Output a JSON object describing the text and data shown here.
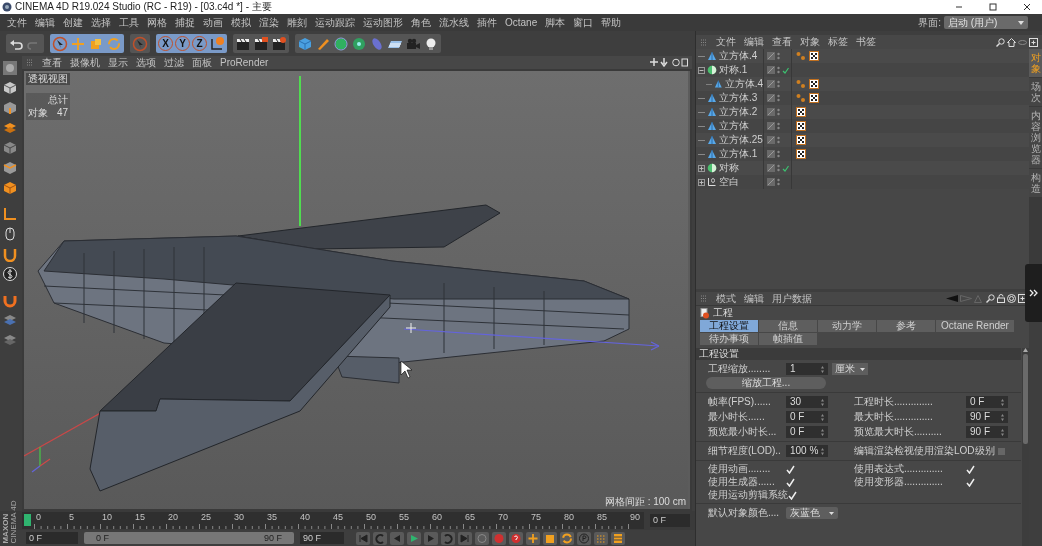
{
  "window": {
    "title": "CINEMA 4D R19.024 Studio (RC - R19) - [03.c4d *] - 主要"
  },
  "menu": [
    "文件",
    "编辑",
    "创建",
    "选择",
    "工具",
    "网格",
    "捕捉",
    "动画",
    "模拟",
    "渲染",
    "雕刻",
    "运动跟踪",
    "运动图形",
    "角色",
    "流水线",
    "插件",
    "Octane",
    "脚本",
    "窗口",
    "帮助"
  ],
  "layout_selector": {
    "label": "界面:",
    "value": "启动 (用户)"
  },
  "axis_buttons": [
    "X",
    "Y",
    "Z"
  ],
  "viewport": {
    "menu": [
      "查看",
      "摄像机",
      "显示",
      "选项",
      "过滤",
      "面板",
      "ProRender"
    ],
    "view_name": "透视视图",
    "hud_title": "总计",
    "hud_rows": [
      {
        "label": "对象",
        "value": "47"
      }
    ],
    "grid_spacing": "网格间距 : 100 cm"
  },
  "timeline": {
    "ticks": [
      "0",
      "5",
      "10",
      "15",
      "20",
      "25",
      "30",
      "35",
      "40",
      "45",
      "50",
      "55",
      "60",
      "65",
      "70",
      "75",
      "80",
      "85",
      "90"
    ],
    "current_frame": "0 F",
    "start": "0 F",
    "range_start": "0 F",
    "range_end": "90 F",
    "end": "90 F"
  },
  "object_manager": {
    "menu": [
      "文件",
      "编辑",
      "查看",
      "对象",
      "标签",
      "书签"
    ],
    "objects": [
      {
        "name": "立方体.4",
        "kind": "cube",
        "enabled": false,
        "tags": [
          {
            "kind": "vertex"
          },
          {
            "kind": "material"
          }
        ]
      },
      {
        "name": "对称.1",
        "kind": "symmetry",
        "enabled": true,
        "expanded": true,
        "children": [
          {
            "name": "立方体.4",
            "kind": "cube",
            "enabled": false,
            "tags": [
              {
                "kind": "vertex"
              },
              {
                "kind": "material"
              }
            ]
          }
        ]
      },
      {
        "name": "立方体.3",
        "kind": "cube",
        "enabled": false,
        "tags": [
          {
            "kind": "vertex"
          },
          {
            "kind": "material"
          }
        ]
      },
      {
        "name": "立方体.2",
        "kind": "cube",
        "enabled": false,
        "tags": [
          {
            "kind": "material"
          }
        ]
      },
      {
        "name": "立方体",
        "kind": "cube",
        "enabled": false,
        "tags": [
          {
            "kind": "material"
          }
        ]
      },
      {
        "name": "立方体.25",
        "kind": "cube",
        "enabled": false,
        "tags": [
          {
            "kind": "material"
          }
        ]
      },
      {
        "name": "立方体.1",
        "kind": "cube",
        "enabled": false,
        "tags": [
          {
            "kind": "material"
          }
        ]
      },
      {
        "name": "对称",
        "kind": "symmetry",
        "enabled": true,
        "expanded": false
      },
      {
        "name": "空白",
        "kind": "null",
        "enabled": false,
        "expanded": false
      }
    ]
  },
  "side_tabs": [
    {
      "label": "对象",
      "selected": true
    },
    {
      "label": "场次",
      "selected": false
    },
    {
      "label": "内容浏览器",
      "selected": false
    },
    {
      "label": "构造",
      "selected": false
    }
  ],
  "attributes": {
    "menu": [
      "模式",
      "编辑",
      "用户数据"
    ],
    "object": "工程",
    "tabs": [
      {
        "label": "工程设置",
        "selected": true
      },
      {
        "label": "信息",
        "selected": false
      },
      {
        "label": "动力学",
        "selected": false
      },
      {
        "label": "参考",
        "selected": false
      },
      {
        "label": "Octane Render",
        "selected": false
      },
      {
        "label": "待办事项",
        "selected": false
      },
      {
        "label": "帧插值",
        "selected": false
      }
    ],
    "section": "工程设置",
    "scale": {
      "label": "工程缩放........",
      "value": "1",
      "unit": "厘米"
    },
    "scale_button": "缩放工程...",
    "time_fields": [
      {
        "label": "帧率(FPS)......",
        "value": "30"
      },
      {
        "label": "工程时长..............",
        "value": "0 F"
      },
      {
        "label": "最小时长......",
        "value": "0 F"
      },
      {
        "label": "最大时长..............",
        "value": "90 F"
      },
      {
        "label": "预览最小时长...",
        "value": "0 F"
      },
      {
        "label": "预览最大时长..........",
        "value": "90 F"
      }
    ],
    "lod": {
      "label": "细节程度(LOD)..",
      "value": "100 %"
    },
    "lod_check": {
      "label": "编辑渲染检视使用渲染LOD级别",
      "checked": false
    },
    "checks": [
      {
        "label": "使用动画........",
        "checked": true
      },
      {
        "label": "使用表达式..............",
        "checked": true
      },
      {
        "label": "使用生成器......",
        "checked": true
      },
      {
        "label": "使用变形器..............",
        "checked": true
      },
      {
        "label": "使用运动剪辑系统",
        "checked": true
      }
    ],
    "color": {
      "label": "默认对象颜色....",
      "value": "灰蓝色"
    }
  },
  "logo": [
    "MAXON",
    "CINEMA 4D"
  ]
}
